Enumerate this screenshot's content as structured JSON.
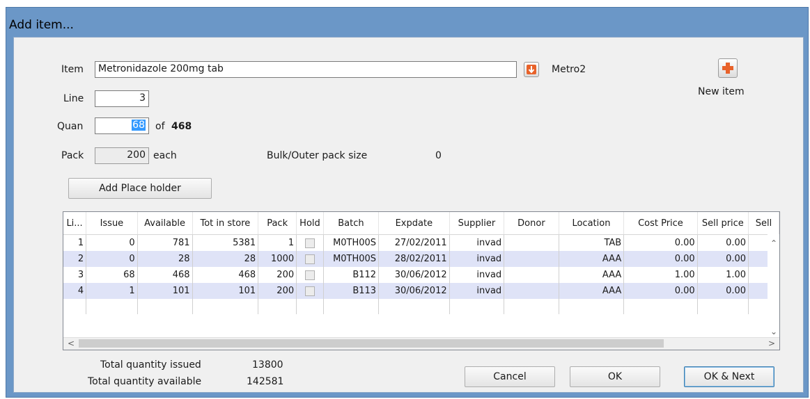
{
  "window": {
    "title": "Add item..."
  },
  "item": {
    "label": "Item",
    "value": "Metronidazole 200mg tab",
    "code": "Metro2"
  },
  "line": {
    "label": "Line",
    "value": "3"
  },
  "quantity": {
    "label": "Quan",
    "value": "68",
    "of_text": "of",
    "of_total": "468"
  },
  "pack": {
    "label": "Pack",
    "value": "200",
    "unit": "each"
  },
  "bulk": {
    "label": "Bulk/Outer pack size",
    "value": "0"
  },
  "buttons": {
    "add_placeholder": "Add Place holder",
    "new_item": "New item",
    "cancel": "Cancel",
    "ok": "OK",
    "ok_next": "OK & Next"
  },
  "icons": {
    "dropdown": "down-arrow-icon",
    "new_item": "plus-icon",
    "accent": "#e8622a"
  },
  "table": {
    "columns": [
      "Li...",
      "Issue",
      "Available",
      "Tot in store",
      "Pack",
      "Hold",
      "Batch",
      "Expdate",
      "Supplier",
      "Donor",
      "Location",
      "Cost Price",
      "Sell price",
      "Sell"
    ],
    "rows": [
      [
        "1",
        "0",
        "781",
        "5381",
        "1",
        "",
        "M0TH00S",
        "27/02/2011",
        "invad",
        "",
        "TAB",
        "0.00",
        "0.00",
        ""
      ],
      [
        "2",
        "0",
        "28",
        "28",
        "1000",
        "",
        "M0TH00S",
        "28/02/2011",
        "invad",
        "",
        "AAA",
        "0.00",
        "0.00",
        ""
      ],
      [
        "3",
        "68",
        "468",
        "468",
        "200",
        "",
        "B112",
        "30/06/2012",
        "invad",
        "",
        "AAA",
        "1.00",
        "1.00",
        ""
      ],
      [
        "4",
        "1",
        "101",
        "101",
        "200",
        "",
        "B113",
        "30/06/2012",
        "invad",
        "",
        "AAA",
        "0.00",
        "0.00",
        ""
      ]
    ]
  },
  "totals": {
    "issued_label": "Total quantity issued",
    "issued_value": "13800",
    "available_label": "Total quantity available",
    "available_value": "142581"
  }
}
